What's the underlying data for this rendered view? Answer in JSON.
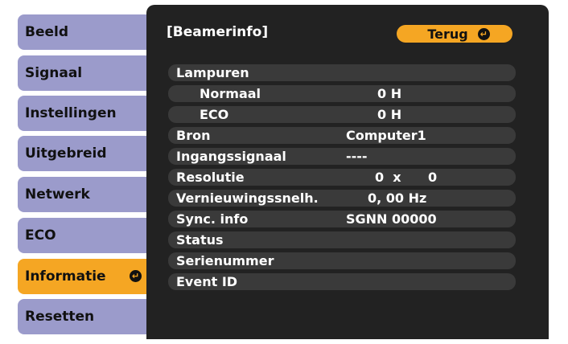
{
  "menu": {
    "items": [
      {
        "label": "Beeld"
      },
      {
        "label": "Signaal"
      },
      {
        "label": "Instellingen"
      },
      {
        "label": "Uitgebreid"
      },
      {
        "label": "Netwerk"
      },
      {
        "label": "ECO"
      },
      {
        "label": "Informatie",
        "selected": true
      },
      {
        "label": "Resetten"
      }
    ]
  },
  "panel": {
    "title": "[Beamerinfo]",
    "back_label": "Terug",
    "rows": [
      {
        "label": "Lampuren",
        "value": ""
      },
      {
        "label": "Normaal",
        "value": "0 H"
      },
      {
        "label": "ECO",
        "value": "0 H"
      },
      {
        "label": "Bron",
        "value": "Computer1"
      },
      {
        "label": "Ingangssignaal",
        "value": "----"
      },
      {
        "label": "Resolutie",
        "value": "0  x      0"
      },
      {
        "label": "Vernieuwingssnelh.",
        "value": "0, 00 Hz"
      },
      {
        "label": "Sync. info",
        "value": "SGNN 00000"
      },
      {
        "label": "Status",
        "value": ""
      },
      {
        "label": "Serienummer",
        "value": ""
      },
      {
        "label": "Event ID",
        "value": ""
      }
    ]
  },
  "colors": {
    "menu_item": "#9b9bcb",
    "menu_selected": "#f5a623",
    "panel_bg": "#222222",
    "row_bg": "#3a3a3a",
    "text_light": "#ffffff",
    "text_dark": "#111111"
  },
  "icons": {
    "enter": "enter-icon"
  }
}
